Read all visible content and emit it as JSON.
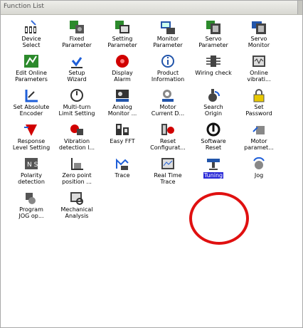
{
  "window": {
    "title": "Function List"
  },
  "highlight_color": "#e01010",
  "items": [
    {
      "label": "Device\nSelect",
      "icon": "device-select-icon"
    },
    {
      "label": "Fixed\nParameter",
      "icon": "fixed-parameter-icon"
    },
    {
      "label": "Setting\nParameter",
      "icon": "setting-parameter-icon"
    },
    {
      "label": "Monitor\nParameter",
      "icon": "monitor-parameter-icon"
    },
    {
      "label": "Servo\nParameter",
      "icon": "servo-parameter-icon"
    },
    {
      "label": "Servo\nMonitor",
      "icon": "servo-monitor-icon"
    },
    {
      "label": "Edit Online\nParameters",
      "icon": "edit-online-icon"
    },
    {
      "label": "Setup\nWizard",
      "icon": "setup-wizard-icon"
    },
    {
      "label": "Display\nAlarm",
      "icon": "alarm-icon"
    },
    {
      "label": "Product\nInformation",
      "icon": "product-info-icon"
    },
    {
      "label": "Wiring check",
      "icon": "wiring-check-icon"
    },
    {
      "label": "Online\nvibrati...",
      "icon": "online-vibration-icon"
    },
    {
      "label": "Set Absolute\nEncoder",
      "icon": "absolute-encoder-icon"
    },
    {
      "label": "Multi-turn\nLimit Setting",
      "icon": "multiturn-limit-icon"
    },
    {
      "label": "Analog\nMonitor ...",
      "icon": "analog-monitor-icon"
    },
    {
      "label": "Motor\nCurrent D...",
      "icon": "motor-current-icon"
    },
    {
      "label": "Search\nOrigin",
      "icon": "search-origin-icon"
    },
    {
      "label": "Set\nPassword",
      "icon": "password-lock-icon"
    },
    {
      "label": "Response\nLevel Setting",
      "icon": "response-level-icon"
    },
    {
      "label": "Vibration\ndetection l...",
      "icon": "vibration-detection-icon"
    },
    {
      "label": "Easy FFT",
      "icon": "easy-fft-icon"
    },
    {
      "label": "Reset\nConfigurat...",
      "icon": "reset-config-icon"
    },
    {
      "label": "Software\nReset",
      "icon": "software-reset-icon"
    },
    {
      "label": "Motor\nparamet...",
      "icon": "motor-parameter-icon"
    },
    {
      "label": "Polarity\ndetection",
      "icon": "polarity-detection-icon"
    },
    {
      "label": "Zero point\nposition ...",
      "icon": "zero-point-icon"
    },
    {
      "label": "Trace",
      "icon": "trace-icon"
    },
    {
      "label": "Real Time\nTrace",
      "icon": "realtime-trace-icon"
    },
    {
      "label": "Tuning",
      "icon": "tuning-icon",
      "selected": true
    },
    {
      "label": "Jog",
      "icon": "jog-icon"
    },
    {
      "label": "Program\nJOG op...",
      "icon": "program-jog-icon"
    },
    {
      "label": "Mechanical\nAnalysis",
      "icon": "mechanical-analysis-icon"
    }
  ]
}
